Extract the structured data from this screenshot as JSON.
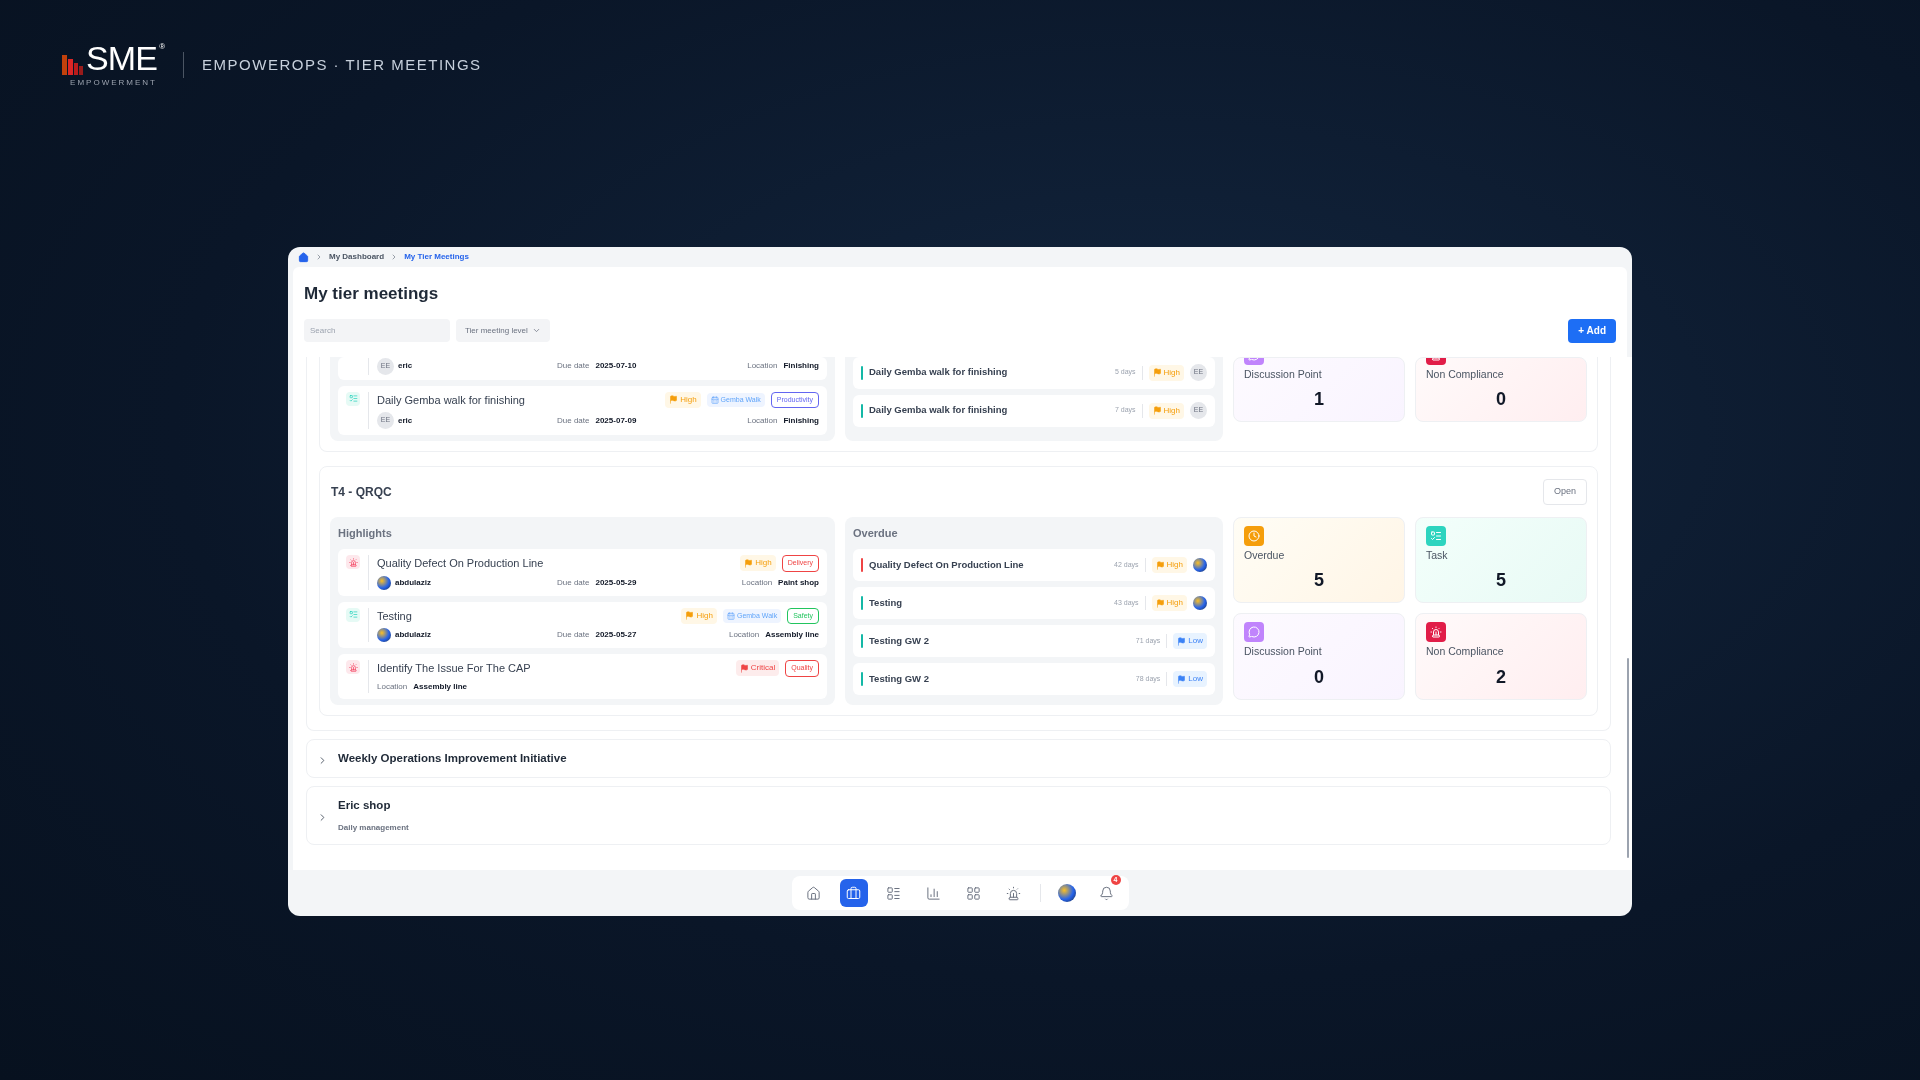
{
  "brand": {
    "logo_text": "SME",
    "registered": "®",
    "logo_sub": "EMPOWERMENT",
    "tagline": "EMPOWEROPS · TIER MEETINGS"
  },
  "breadcrumb": [
    {
      "label": "My Dashboard",
      "current": false
    },
    {
      "label": "My Tier Meetings",
      "current": true
    }
  ],
  "page_title": "My tier meetings",
  "search": {
    "placeholder": "Search"
  },
  "filter": {
    "label": "Tier meeting level"
  },
  "add_button": "+ Add",
  "meetings": [
    {
      "kind": "clipped",
      "highlights": [
        {
          "kind": "cut",
          "user": {
            "name": "eric",
            "kind": "initials",
            "initials": "EE"
          },
          "due_label": "Due date",
          "due": "2025-07-10",
          "location_label": "Location",
          "location": "Finishing"
        },
        {
          "kind": "task",
          "title": "Daily Gemba walk for finishing",
          "user": {
            "name": "eric",
            "kind": "initials",
            "initials": "EE"
          },
          "due_label": "Due date",
          "due": "2025-07-09",
          "location_label": "Location",
          "location": "Finishing",
          "priority": {
            "label": "High",
            "kind": "high"
          },
          "tags": [
            {
              "label": "Gemba Walk",
              "kind": "category"
            },
            {
              "label": "Productivity",
              "kind": "outline",
              "color": "#6366f1"
            }
          ]
        }
      ],
      "overdue": [
        {
          "title": "Daily Gemba walk for finishing",
          "color": "#14b8a6",
          "age": "5 days",
          "priority": {
            "label": "High",
            "kind": "high"
          },
          "assignee": {
            "kind": "initials",
            "initials": "EE"
          }
        },
        {
          "title": "Daily Gemba walk for finishing",
          "color": "#14b8a6",
          "age": "7 days",
          "priority": {
            "label": "High",
            "kind": "high"
          },
          "assignee": {
            "kind": "initials",
            "initials": "EE"
          }
        }
      ],
      "stats": [
        {
          "label": "Discussion Point",
          "value": "1",
          "kind": "discussion",
          "color": "#c084fc"
        },
        {
          "label": "Non Compliance",
          "value": "0",
          "kind": "noncompliance",
          "color": "#e11d48"
        }
      ]
    },
    {
      "kind": "full",
      "title": "T4 - QRQC",
      "open_button": "Open",
      "highlights_title": "Highlights",
      "overdue_title": "Overdue",
      "highlights": [
        {
          "kind": "noncompliance",
          "title": "Quality Defect On Production Line",
          "user": {
            "name": "abdulaziz",
            "kind": "photo"
          },
          "due_label": "Due date",
          "due": "2025-05-29",
          "location_label": "Location",
          "location": "Paint shop",
          "priority": {
            "label": "High",
            "kind": "high"
          },
          "tags": [
            {
              "label": "Delivery",
              "kind": "outline",
              "color": "#ef4444"
            }
          ]
        },
        {
          "kind": "task",
          "title": "Testing",
          "user": {
            "name": "abdulaziz",
            "kind": "photo"
          },
          "due_label": "Due date",
          "due": "2025-05-27",
          "location_label": "Location",
          "location": "Assembly line",
          "priority": {
            "label": "High",
            "kind": "high"
          },
          "tags": [
            {
              "label": "Gemba Walk",
              "kind": "category"
            },
            {
              "label": "Safety",
              "kind": "outline",
              "color": "#22c55e"
            }
          ]
        },
        {
          "kind": "noncompliance",
          "title": "Identify The Issue For The CAP",
          "location_label": "Location",
          "location": "Assembly line",
          "priority": {
            "label": "Critical",
            "kind": "critical"
          },
          "tags": [
            {
              "label": "Quality",
              "kind": "outline",
              "color": "#ef4444"
            }
          ]
        }
      ],
      "overdue": [
        {
          "title": "Quality Defect On Production Line",
          "color": "#ef4444",
          "age": "42 days",
          "priority": {
            "label": "High",
            "kind": "high"
          },
          "assignee": {
            "kind": "photo"
          }
        },
        {
          "title": "Testing",
          "color": "#14b8a6",
          "age": "43 days",
          "priority": {
            "label": "High",
            "kind": "high"
          },
          "assignee": {
            "kind": "photo"
          }
        },
        {
          "title": "Testing GW 2",
          "color": "#14b8a6",
          "age": "71 days",
          "priority": {
            "label": "Low",
            "kind": "low"
          }
        },
        {
          "title": "Testing GW 2",
          "color": "#14b8a6",
          "age": "78 days",
          "priority": {
            "label": "Low",
            "kind": "low"
          }
        }
      ],
      "stats": [
        {
          "label": "Overdue",
          "value": "5",
          "kind": "overdue",
          "color": "#f59e0b"
        },
        {
          "label": "Task",
          "value": "5",
          "kind": "task",
          "color": "#2dd4bf"
        },
        {
          "label": "Discussion Point",
          "value": "0",
          "kind": "discussion",
          "color": "#c084fc"
        },
        {
          "label": "Non Compliance",
          "value": "2",
          "kind": "noncompliance",
          "color": "#e11d48"
        }
      ]
    }
  ],
  "collapsed": [
    {
      "title": "Weekly Operations Improvement Initiative"
    },
    {
      "title": "Eric shop",
      "subtitle": "Daily management"
    }
  ],
  "dock": [
    {
      "kind": "home",
      "selected": false
    },
    {
      "kind": "briefcase",
      "selected": true
    },
    {
      "kind": "table",
      "selected": false
    },
    {
      "kind": "chart",
      "selected": false
    },
    {
      "kind": "grid",
      "selected": false
    },
    {
      "kind": "alarm",
      "selected": false
    },
    {
      "kind": "avatar",
      "selected": false
    },
    {
      "kind": "bell",
      "selected": false,
      "badge": "4"
    }
  ]
}
